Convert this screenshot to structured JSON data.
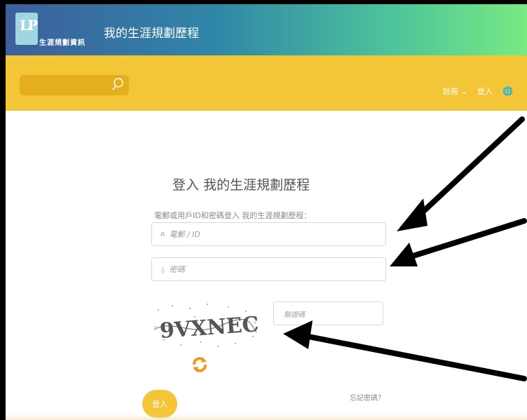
{
  "header": {
    "logo_text": "生涯規劃資訊",
    "app_title": "我的生涯規劃歷程"
  },
  "navbar": {
    "search_icon": "search-icon",
    "register_label": "註冊",
    "login_label": "登入",
    "globe_icon": "globe-icon"
  },
  "login": {
    "heading": "登入 我的生涯規劃歷程",
    "instruction": "電郵或用戶ID和密碼登入 我的生涯規劃歷程：",
    "email_placeholder": "電郵 / ID",
    "password_placeholder": "密碼",
    "captcha_text": "9VXNEC",
    "captcha_placeholder": "驗證碼",
    "refresh_icon": "refresh-icon",
    "submit_label": "登入",
    "forgot_label": "忘記密碼？"
  },
  "colors": {
    "header_gradient_start": "#3d5f9c",
    "header_gradient_end": "#78ea82",
    "navbar_yellow": "#f2c637",
    "search_box": "#e4ae1c",
    "refresh_orange": "#f39a1e"
  }
}
